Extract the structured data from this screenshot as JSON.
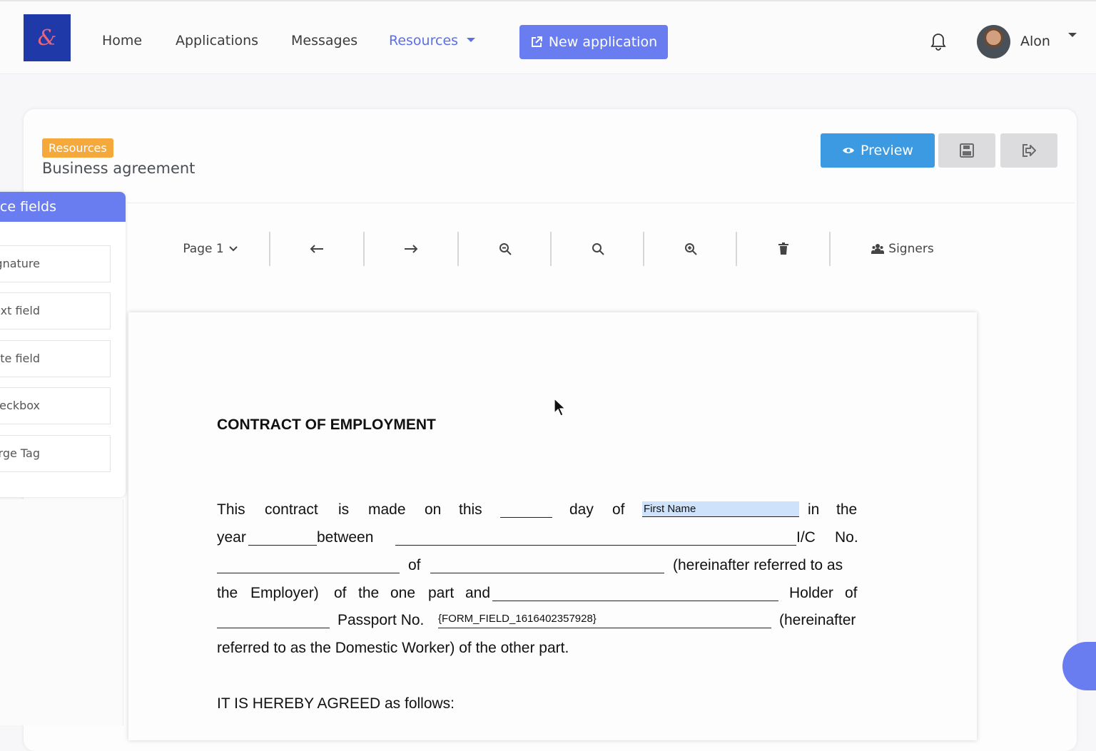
{
  "brand": {
    "logo_glyph": "&",
    "logo_bg": "#1f3aa8",
    "accent": "#6a7df0"
  },
  "nav": {
    "home": "Home",
    "applications": "Applications",
    "messages": "Messages",
    "resources": "Resources",
    "new_application": "New application"
  },
  "user": {
    "name": "Alon"
  },
  "page": {
    "breadcrumb": "Resources",
    "title": "Business agreement",
    "preview": "Preview"
  },
  "fields_panel": {
    "header": "ace fields",
    "items": [
      "gnature",
      "ext field",
      "ate field",
      "heckbox",
      "lerge Tag"
    ]
  },
  "toolbar": {
    "page": "Page 1",
    "signers": "Signers"
  },
  "document": {
    "title": "CONTRACT OF EMPLOYMENT",
    "line1_words": [
      "This",
      "contract",
      "is",
      "made",
      "on",
      "this",
      "day",
      "of",
      "in",
      "the"
    ],
    "first_name_field": "First Name",
    "line2": {
      "year": "year",
      "between": "between",
      "ic": "I/C",
      "no": "No."
    },
    "line3": {
      "of": "of",
      "hereinafter": "(hereinafter referred to as"
    },
    "line4": {
      "the": "the",
      "employer": "Employer)",
      "of": "of",
      "the2": "the",
      "one": "one",
      "part": "part",
      "and": "and",
      "holder": "Holder",
      "of2": "of"
    },
    "line5": {
      "passport": "Passport No.",
      "form_field": "{FORM_FIELD_1616402357928}",
      "hereinafter": "(hereinafter"
    },
    "line6": "referred to as the Domestic Worker) of the other part.",
    "agreed": "IT IS HEREBY AGREED as follows:"
  }
}
